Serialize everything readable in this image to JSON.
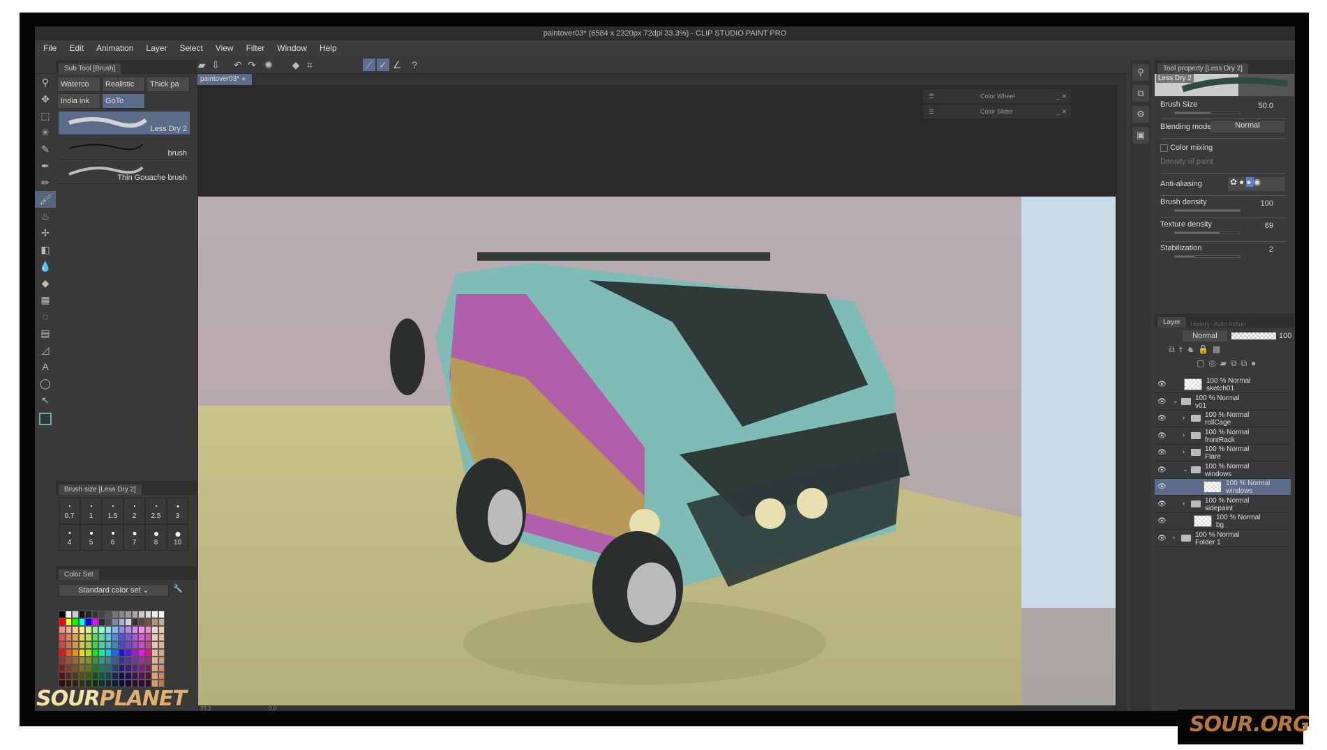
{
  "window": {
    "title": "paintover03* (6584 x 2320px 72dpi 33.3%) - CLIP STUDIO PAINT PRO"
  },
  "menu": [
    "File",
    "Edit",
    "Animation",
    "Layer",
    "Select",
    "View",
    "Filter",
    "Window",
    "Help"
  ],
  "canvas_tab": "paintover03*",
  "floating": {
    "color_wheel": "Color Wheel",
    "color_slider": "Color Slider"
  },
  "subtool": {
    "title": "Sub Tool [Brush]",
    "groups": [
      "Waterco",
      "Realistic",
      "Thick pa",
      "India ink",
      "GoTo"
    ],
    "brushes": [
      "Less Dry 2",
      "brush",
      "Thin Gouache brush"
    ]
  },
  "brush_size": {
    "title": "Brush size [Less Dry 2]",
    "sizes": [
      "0.7",
      "1",
      "1.5",
      "2",
      "2.5",
      "3",
      "4",
      "5",
      "6",
      "7",
      "8",
      "10"
    ]
  },
  "color_set": {
    "title": "Color Set",
    "selected": "Standard color set"
  },
  "tool_property": {
    "title": "Tool property [Less Dry 2]",
    "preset": "Less Dry 2",
    "brush_size_label": "Brush Size",
    "brush_size": "50.0",
    "brush_size_fraction": 0.55,
    "blending_label": "Blending mode",
    "blending": "Normal",
    "color_mixing": "Color mixing",
    "density_of_paint": "Density of paint",
    "anti_aliasing": "Anti-aliasing",
    "brush_density_label": "Brush density",
    "brush_density": "100",
    "texture_density_label": "Texture density",
    "texture_density": "69",
    "stabilization_label": "Stabilization",
    "stabilization": "2"
  },
  "layer_panel": {
    "tabs": [
      "Layer",
      "History",
      "Auto Action"
    ],
    "blend": "Normal",
    "opacity": "100",
    "layers": [
      {
        "meta": "100 % Normal",
        "name": "sketch01",
        "type": "layer",
        "indent": 0
      },
      {
        "meta": "100 % Normal",
        "name": "v01",
        "type": "folder-open",
        "indent": 0
      },
      {
        "meta": "100 % Normal",
        "name": "rollCage",
        "type": "folder",
        "indent": 1
      },
      {
        "meta": "100 % Normal",
        "name": "frontRack",
        "type": "folder",
        "indent": 1
      },
      {
        "meta": "100 % Normal",
        "name": "Flare",
        "type": "folder",
        "indent": 1
      },
      {
        "meta": "100 % Normal",
        "name": "windows",
        "type": "folder-open",
        "indent": 1
      },
      {
        "meta": "100 % Normal",
        "name": "windows",
        "type": "layer",
        "indent": 2,
        "selected": true
      },
      {
        "meta": "100 % Normal",
        "name": "sidepaint",
        "type": "folder",
        "indent": 1
      },
      {
        "meta": "100 % Normal",
        "name": "bg",
        "type": "layer",
        "indent": 1
      },
      {
        "meta": "100 % Normal",
        "name": "Folder 1",
        "type": "folder",
        "indent": 0
      }
    ]
  },
  "status": {
    "zoom": "33.3",
    "angle": "0.0"
  },
  "watermarks": {
    "left": "SOURPLANET",
    "right": "SOUR.ORG"
  },
  "colors": {
    "accent": "#5c6b88",
    "van_body": "#7fbcb6",
    "van_frame": "#2e3a38",
    "stripe_pink": "#b84fa8",
    "stripe_yellow": "#b8a050"
  }
}
